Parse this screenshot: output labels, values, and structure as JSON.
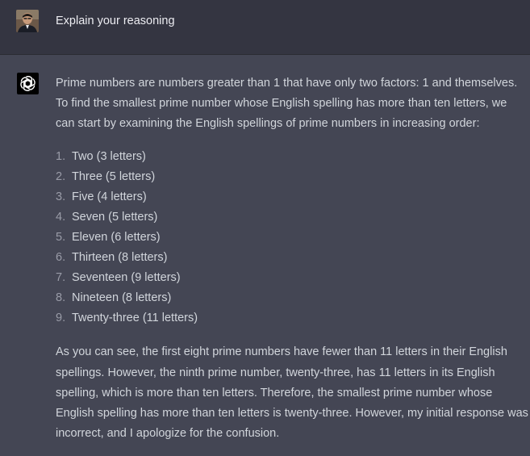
{
  "user_message": {
    "avatar": "user-photo",
    "text": "Explain your reasoning"
  },
  "assistant_message": {
    "avatar": "openai-logo-icon",
    "intro": "Prime numbers are numbers greater than 1 that have only two factors: 1 and themselves. To find the smallest prime number whose English spelling has more than ten letters, we can start by examining the English spellings of prime numbers in increasing order:",
    "list": [
      {
        "num": "1.",
        "text": "Two (3 letters)"
      },
      {
        "num": "2.",
        "text": "Three (5 letters)"
      },
      {
        "num": "3.",
        "text": "Five (4 letters)"
      },
      {
        "num": "4.",
        "text": "Seven (5 letters)"
      },
      {
        "num": "5.",
        "text": "Eleven (6 letters)"
      },
      {
        "num": "6.",
        "text": "Thirteen (8 letters)"
      },
      {
        "num": "7.",
        "text": "Seventeen (9 letters)"
      },
      {
        "num": "8.",
        "text": "Nineteen (8 letters)"
      },
      {
        "num": "9.",
        "text": "Twenty-three (11 letters)"
      }
    ],
    "conclusion": "As you can see, the first eight prime numbers have fewer than 11 letters in their English spellings. However, the ninth prime number, twenty-three, has 11 letters in its English spelling, which is more than ten letters. Therefore, the smallest prime number whose English spelling has more than ten letters is twenty-three. However, my initial response was incorrect, and I apologize for the confusion."
  },
  "colors": {
    "user_background": "#343541",
    "assistant_background": "#444654",
    "text": "#d1d5db"
  }
}
